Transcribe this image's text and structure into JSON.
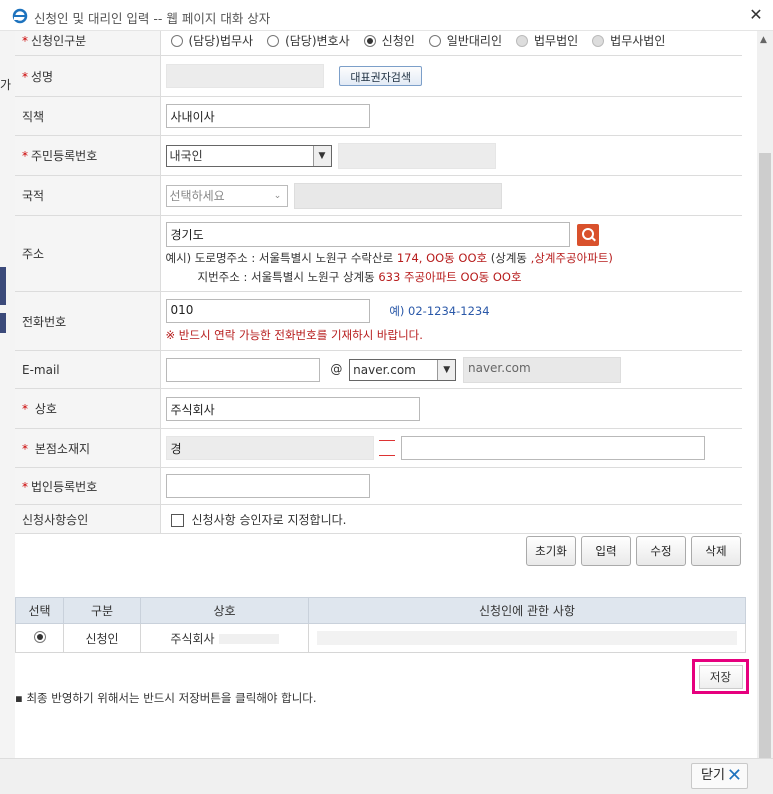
{
  "window": {
    "title": "신청인 및 대리인 입력 -- 웹 페이지 대화 상자"
  },
  "behind": {
    "char": "가"
  },
  "form": {
    "applicant_type": {
      "label": "신청인구분",
      "options": [
        {
          "label": "(담당)법무사",
          "checked": false,
          "disabled": false
        },
        {
          "label": "(담당)변호사",
          "checked": false,
          "disabled": false
        },
        {
          "label": "신청인",
          "checked": true,
          "disabled": false
        },
        {
          "label": "일반대리인",
          "checked": false,
          "disabled": false
        },
        {
          "label": "법무법인",
          "checked": false,
          "disabled": true
        },
        {
          "label": "법무사법인",
          "checked": false,
          "disabled": true
        }
      ]
    },
    "name": {
      "label": "성명",
      "value": "",
      "search_button": "대표권자검색"
    },
    "position": {
      "label": "직책",
      "value": "사내이사"
    },
    "rrn": {
      "label": "주민등록번호",
      "select_value": "내국인",
      "value": ""
    },
    "nationality": {
      "label": "국적",
      "select_value": "선택하세요",
      "value": ""
    },
    "address": {
      "label": "주소",
      "value": "경기도 ",
      "example_road_prefix": "예시) 도로명주소 : 서울특별시 노원구 수락산로 ",
      "example_road_red": "174, OO동 OO호",
      "example_road_mid": " (상계동 ",
      "example_road_red2": ",상계주공아파트)",
      "example_lot_prefix": "지번주소 : 서울특별시 노원구 상계동 ",
      "example_lot_red": "633 주공아파트 OO동 OO호"
    },
    "phone": {
      "label": "전화번호",
      "value": "010",
      "example": "예) 02-1234-1234",
      "notice": "※ 반드시 연락 가능한 전화번호를 기재하시 바랍니다."
    },
    "email": {
      "label": "E-mail",
      "value": "",
      "at": "@",
      "domain_select": "naver.com",
      "domain_value": "naver.com"
    },
    "company": {
      "label": "상호",
      "value": "주식회사"
    },
    "hq_location": {
      "label": "본점소재지",
      "value": "경",
      "value2": ""
    },
    "corp_reg_no": {
      "label": "법인등록번호",
      "value": ""
    },
    "approver": {
      "label": "신청사항승인",
      "checkbox_label": "신청사항 승인자로 지정합니다."
    }
  },
  "action_buttons": [
    "초기화",
    "입력",
    "수정",
    "삭제"
  ],
  "grid": {
    "headers": [
      "선택",
      "구분",
      "상호",
      "신청인에 관한 사항"
    ],
    "rows": [
      {
        "type": "신청인",
        "company": "주식회사",
        "details": ""
      }
    ]
  },
  "save_button": "저장",
  "note": "▪ 최종 반영하기 위해서는 반드시 저장버튼을 클릭해야 합니다.",
  "close_button": "닫기"
}
